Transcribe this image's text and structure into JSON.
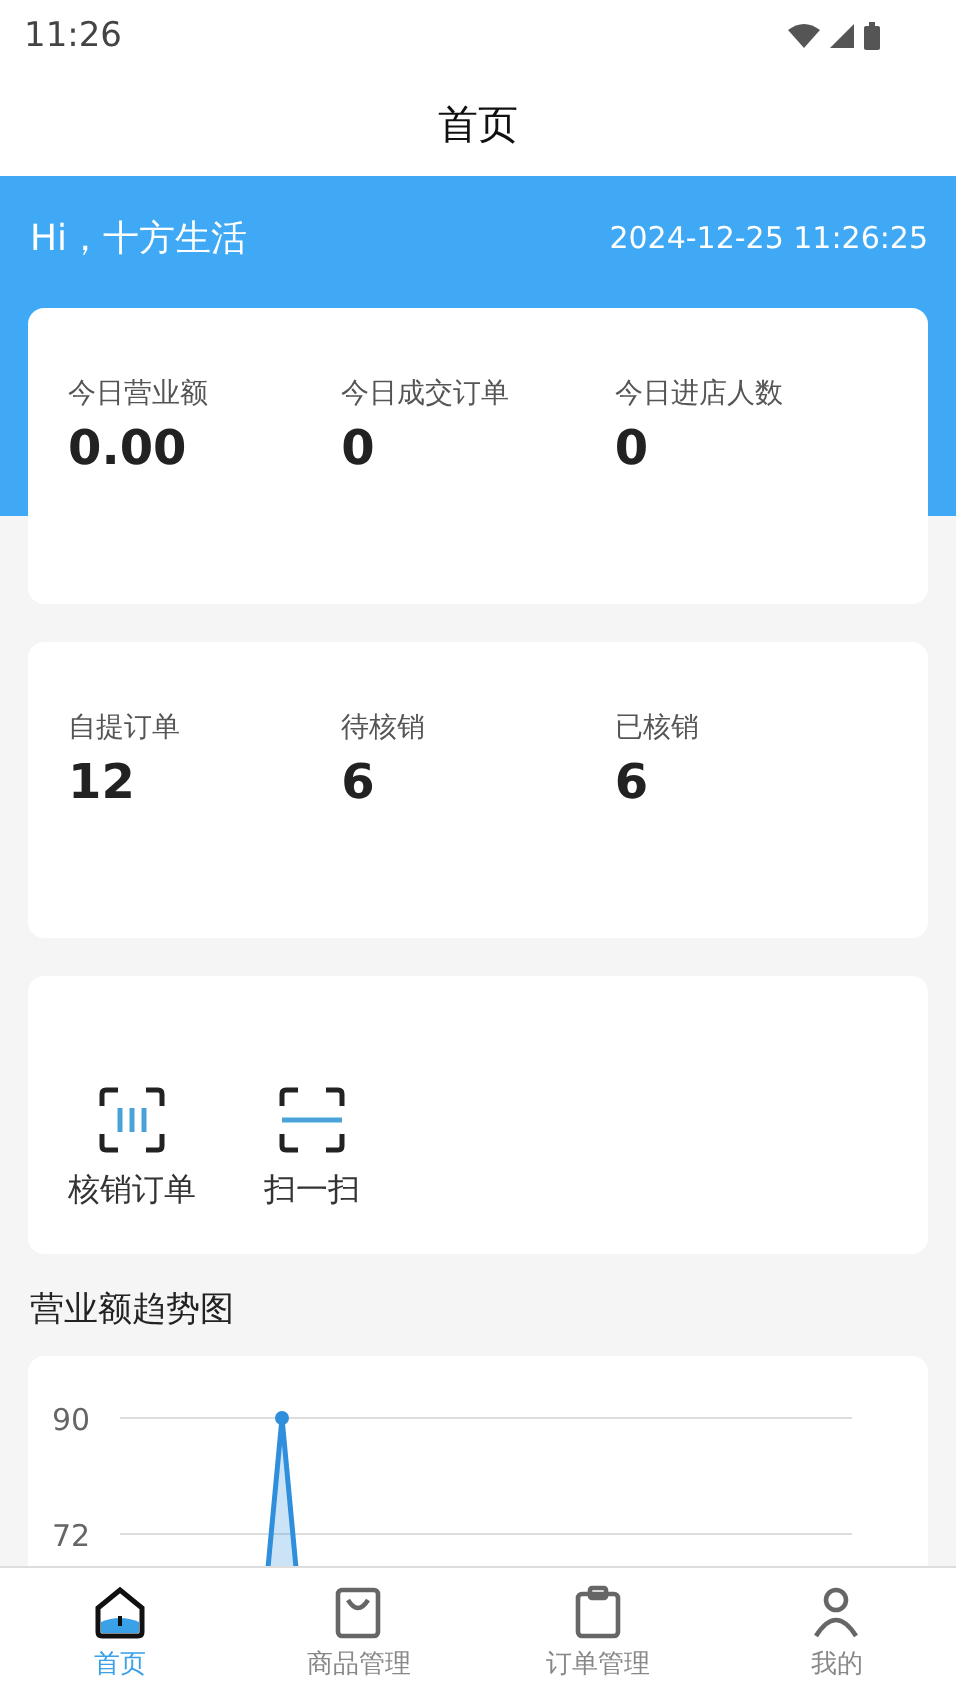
{
  "status_bar": {
    "time": "11:26"
  },
  "title": "首页",
  "header": {
    "greeting": "Hi，十方生活",
    "datetime": "2024-12-25 11:26:25"
  },
  "stat_cards": [
    {
      "items": [
        {
          "label": "今日营业额",
          "value": "0.00"
        },
        {
          "label": "今日成交订单",
          "value": "0"
        },
        {
          "label": "今日进店人数",
          "value": "0"
        }
      ]
    },
    {
      "items": [
        {
          "label": "自提订单",
          "value": "12"
        },
        {
          "label": "待核销",
          "value": "6"
        },
        {
          "label": "已核销",
          "value": "6"
        }
      ]
    }
  ],
  "actions": [
    {
      "kind": "verify",
      "label": "核销订单"
    },
    {
      "kind": "scan",
      "label": "扫一扫"
    }
  ],
  "trend": {
    "title": "营业额趋势图",
    "axis_labels": [
      "90",
      "72"
    ]
  },
  "tab_bar": [
    {
      "kind": "home",
      "label": "首页",
      "selected": true
    },
    {
      "kind": "bag",
      "label": "商品管理",
      "selected": false
    },
    {
      "kind": "clipboard",
      "label": "订单管理",
      "selected": false
    },
    {
      "kind": "person",
      "label": "我的",
      "selected": false
    }
  ]
}
